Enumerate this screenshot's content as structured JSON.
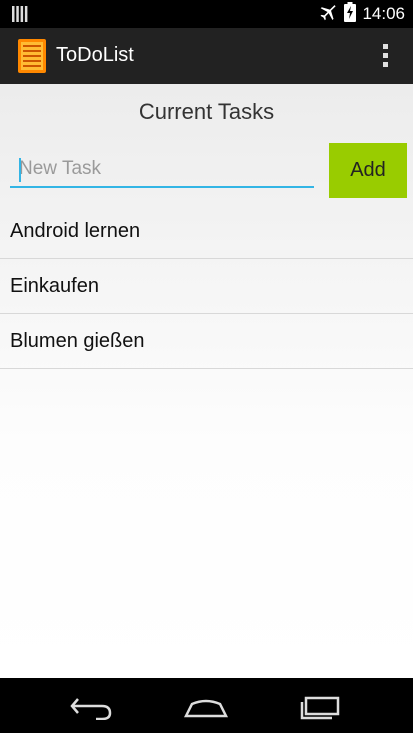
{
  "status_bar": {
    "time": "14:06",
    "icons": [
      "signal-bars-icon",
      "airplane-mode-icon",
      "battery-charging-icon"
    ]
  },
  "action_bar": {
    "app_icon": "notepad-icon",
    "title": "ToDoList",
    "overflow_icon": "more-vertical-icon"
  },
  "main": {
    "heading": "Current Tasks",
    "new_task": {
      "placeholder": "New Task",
      "value": ""
    },
    "add_label": "Add",
    "tasks": [
      "Android lernen",
      "Einkaufen",
      "Blumen gießen"
    ]
  },
  "nav_bar": {
    "icons": [
      "back-icon",
      "home-icon",
      "recents-icon"
    ]
  },
  "colors": {
    "action_bar": "#222222",
    "accent": "#33b5e5",
    "add_button": "#99cc00",
    "app_icon": "#ff8800"
  }
}
